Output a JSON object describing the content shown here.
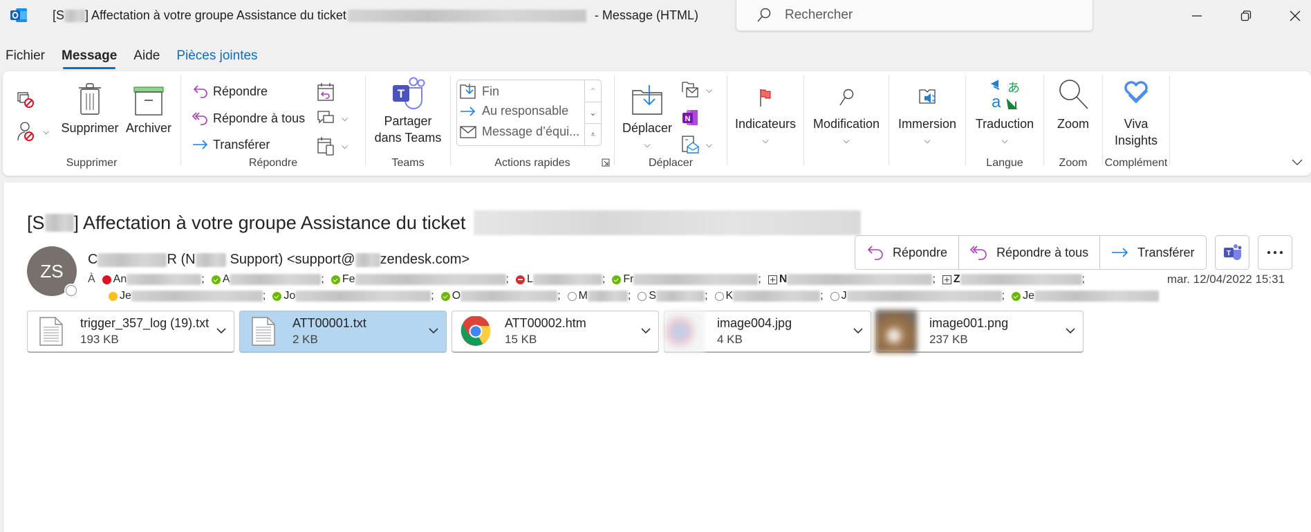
{
  "window": {
    "title_prefix": "[S",
    "title_mid": "] Affectation à votre groupe Assistance du ticket ",
    "title_suffix": "-  Message (HTML)",
    "search_placeholder": "Rechercher"
  },
  "tabs": [
    {
      "label": "Fichier",
      "active": false
    },
    {
      "label": "Message",
      "active": true
    },
    {
      "label": "Aide",
      "active": false
    },
    {
      "label": "Pièces jointes",
      "active": false,
      "contextual": true
    }
  ],
  "ribbon": {
    "groups": {
      "supprimer": {
        "label": "Supprimer",
        "delete": "Supprimer",
        "archive": "Archiver"
      },
      "repondre": {
        "label": "Répondre",
        "reply": "Répondre",
        "reply_all": "Répondre à tous",
        "forward": "Transférer"
      },
      "teams": {
        "label": "Teams",
        "share_line1": "Partager",
        "share_line2": "dans Teams"
      },
      "actions_rapides": {
        "label": "Actions rapides",
        "items": [
          "Fin",
          "Au responsable",
          "Message d’équi..."
        ]
      },
      "deplacer": {
        "label": "Déplacer",
        "move": "Déplacer"
      },
      "indicateurs": {
        "label": "Indicateurs"
      },
      "modification": {
        "label": "Modification"
      },
      "immersion": {
        "label": "Immersion"
      },
      "langue": {
        "label": "Langue",
        "translate": "Traduction"
      },
      "zoom": {
        "label": "Zoom",
        "zoom": "Zoom"
      },
      "complement": {
        "label": "Complément",
        "viva_line1": "Viva",
        "viva_line2": "Insights"
      }
    }
  },
  "message": {
    "subject_prefix": "[S",
    "subject_mid": "] Affectation à votre groupe Assistance du ticket",
    "avatar_initials": "ZS",
    "sender_a": "C",
    "sender_b": "R (N",
    "sender_c": "Support) <support@",
    "sender_d": "zendesk.com>",
    "to_label": "À",
    "recipients_line1": [
      {
        "status": "busy",
        "prefix": "An"
      },
      {
        "status": "available",
        "prefix": "A"
      },
      {
        "status": "available",
        "prefix": "Fe"
      },
      {
        "status": "dnd",
        "prefix": "L"
      },
      {
        "status": "available",
        "prefix": "Fr"
      },
      {
        "status": "group",
        "prefix": "N"
      },
      {
        "status": "group",
        "prefix": "Z"
      }
    ],
    "recipients_line2": [
      {
        "status": "away",
        "prefix": "Je"
      },
      {
        "status": "available",
        "prefix": "Jo"
      },
      {
        "status": "available",
        "prefix": "O"
      },
      {
        "status": "offline",
        "prefix": "M"
      },
      {
        "status": "offline",
        "prefix": "S"
      },
      {
        "status": "offline",
        "prefix": "K"
      },
      {
        "status": "offline",
        "prefix": "J"
      },
      {
        "status": "available",
        "prefix": "Je"
      }
    ],
    "date": "mar. 12/04/2022 15:31",
    "actions": {
      "reply": "Répondre",
      "reply_all": "Répondre à tous",
      "forward": "Transférer"
    },
    "attachments": [
      {
        "name": "trigger_357_log (19).txt",
        "size": "193 KB",
        "type": "txt",
        "selected": false
      },
      {
        "name": "ATT00001.txt",
        "size": "2 KB",
        "type": "txt",
        "selected": true
      },
      {
        "name": "ATT00002.htm",
        "size": "15 KB",
        "type": "chrome",
        "selected": false
      },
      {
        "name": "image004.jpg",
        "size": "4 KB",
        "type": "image",
        "selected": false
      },
      {
        "name": "image001.png",
        "size": "237 KB",
        "type": "image",
        "selected": false
      }
    ]
  }
}
